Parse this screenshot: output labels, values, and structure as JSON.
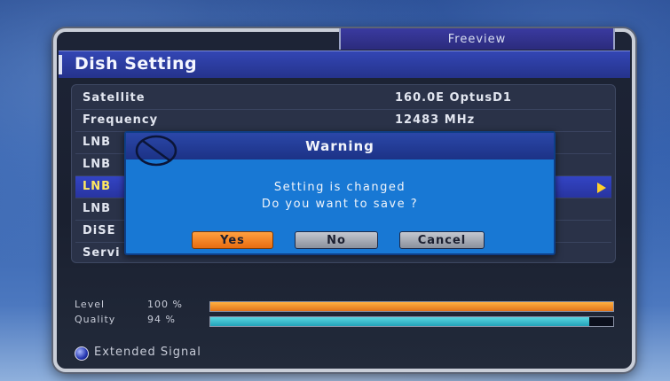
{
  "header": {
    "tab_label": "Freeview",
    "title": "Dish Setting"
  },
  "settings": {
    "rows": [
      {
        "label": "Satellite",
        "value": "160.0E OptusD1"
      },
      {
        "label": "Frequency",
        "value": "12483 MHz"
      },
      {
        "label": "LNB",
        "value": ""
      },
      {
        "label": "LNB",
        "value": ""
      },
      {
        "label": "LNB",
        "value": ""
      },
      {
        "label": "LNB",
        "value": ""
      },
      {
        "label": "DiSE",
        "value": ""
      },
      {
        "label": "Servi",
        "value": ""
      }
    ],
    "selected_index": 4
  },
  "signal": {
    "level_label": "Level",
    "level_value": "100 %",
    "level_fraction": 1.0,
    "quality_label": "Quality",
    "quality_value": "94 %",
    "quality_fraction": 0.94
  },
  "footer": {
    "label": "Extended Signal"
  },
  "dialog": {
    "title": "Warning",
    "message_line1": "Setting is changed",
    "message_line2": "Do you want to save ?",
    "yes_label": "Yes",
    "no_label": "No",
    "cancel_label": "Cancel"
  },
  "colors": {
    "highlight_row": "#2834a0",
    "dialog_bg": "#1878d4",
    "yes_button": "#e86c10",
    "level_bar": "#e0741a",
    "quality_bar": "#22a2b8"
  },
  "icons": {
    "dialog": "prohibited-icon",
    "row_arrow": "arrow-right-icon",
    "footer": "blue-dot-icon"
  }
}
